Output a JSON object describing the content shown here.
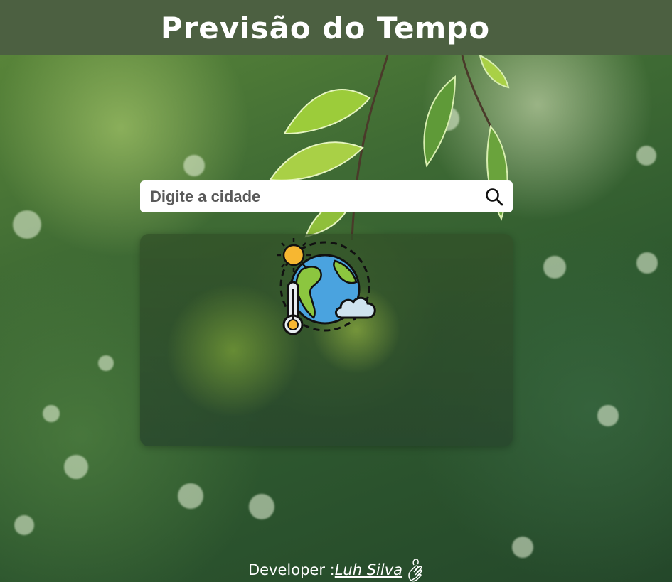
{
  "header": {
    "title": "Previsão do Tempo"
  },
  "search": {
    "placeholder": "Digite a cidade",
    "icon": "search-icon"
  },
  "card": {
    "icon": "weather-globe-icon"
  },
  "footer": {
    "prefix": "Developer :",
    "author": "Luh Silva",
    "icon": "hands-icon"
  },
  "colors": {
    "header_bg": "#4c6041",
    "search_bg": "#ffffff",
    "text": "#ffffff"
  }
}
